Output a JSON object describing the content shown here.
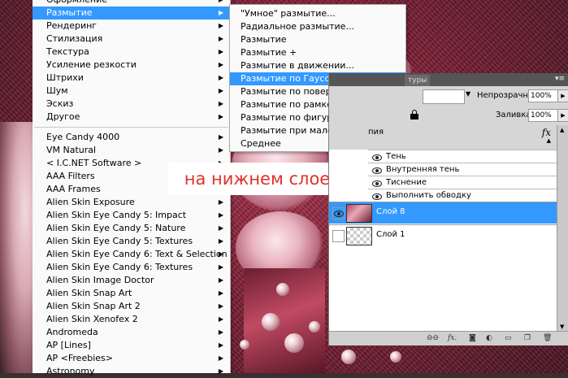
{
  "main_menu": {
    "items": [
      {
        "label": "Оформление",
        "arrow": true
      },
      {
        "label": "Размытие",
        "arrow": true,
        "selected": true
      },
      {
        "label": "Рендеринг",
        "arrow": true
      },
      {
        "label": "Стилизация",
        "arrow": true
      },
      {
        "label": "Текстура",
        "arrow": true
      },
      {
        "label": "Усиление резкости",
        "arrow": true
      },
      {
        "label": "Штрихи",
        "arrow": true
      },
      {
        "label": "Шум",
        "arrow": true
      },
      {
        "label": "Эскиз",
        "arrow": true
      },
      {
        "label": "Другое",
        "arrow": true
      }
    ],
    "plugins": [
      {
        "label": "Eye Candy 4000",
        "arrow": true
      },
      {
        "label": "VM Natural",
        "arrow": true
      },
      {
        "label": "< I.C.NET Software >",
        "arrow": true
      },
      {
        "label": "AAA Filters",
        "arrow": true
      },
      {
        "label": "AAA Frames",
        "arrow": true
      },
      {
        "label": "Alien Skin Exposure",
        "arrow": true
      },
      {
        "label": "Alien Skin Eye Candy 5: Impact",
        "arrow": true
      },
      {
        "label": "Alien Skin Eye Candy 5: Nature",
        "arrow": true
      },
      {
        "label": "Alien Skin Eye Candy 5: Textures",
        "arrow": true
      },
      {
        "label": "Alien Skin Eye Candy 6: Text & Selection",
        "arrow": true
      },
      {
        "label": "Alien Skin Eye Candy 6: Textures",
        "arrow": true
      },
      {
        "label": "Alien Skin Image Doctor",
        "arrow": true
      },
      {
        "label": "Alien Skin Snap Art",
        "arrow": true
      },
      {
        "label": "Alien Skin Snap Art 2",
        "arrow": true
      },
      {
        "label": "Alien Skin Xenofex 2",
        "arrow": true
      },
      {
        "label": "Andromeda",
        "arrow": true
      },
      {
        "label": "AP [Lines]",
        "arrow": true
      },
      {
        "label": "AP <Freebies>",
        "arrow": true
      },
      {
        "label": "Astronomy",
        "arrow": true
      }
    ]
  },
  "blur_submenu": {
    "items": [
      {
        "label": "\"Умное\" размытие..."
      },
      {
        "label": "Радиальное размытие..."
      },
      {
        "label": "Размытие"
      },
      {
        "label": "Размытие +"
      },
      {
        "label": "Размытие в движении..."
      },
      {
        "label": "Размытие по Гауссу...",
        "selected": true
      },
      {
        "label": "Размытие по поверхности..."
      },
      {
        "label": "Размытие по рамке..."
      },
      {
        "label": "Размытие по фигуре..."
      },
      {
        "label": "Размытие при малой глубине резкости..."
      },
      {
        "label": "Среднее"
      }
    ]
  },
  "annotation": {
    "text": "на нижнем слое"
  },
  "layers_panel": {
    "tab_label": "туры",
    "opacity_label": "Непрозрачность:",
    "opacity_value": "100%",
    "fill_label": "Заливка:",
    "fill_value": "100%",
    "fx_label": "fx",
    "effects_header_partial": "пия",
    "effects": [
      "Тень",
      "Внутренняя тень",
      "Тиснение",
      "Выполнить обводку"
    ],
    "layers": [
      {
        "name": "Слой 8",
        "active": true,
        "visible": true
      },
      {
        "name": "Слой 1",
        "active": false,
        "visible": false
      }
    ],
    "footer_icons": [
      "link-icon",
      "fx-icon",
      "mask-icon",
      "adjustment-icon",
      "folder-icon",
      "new-layer-icon",
      "trash-icon"
    ],
    "footer_fx": "fx."
  },
  "colors": {
    "selection": "#3399ff",
    "annotation_text": "#e0302a"
  }
}
